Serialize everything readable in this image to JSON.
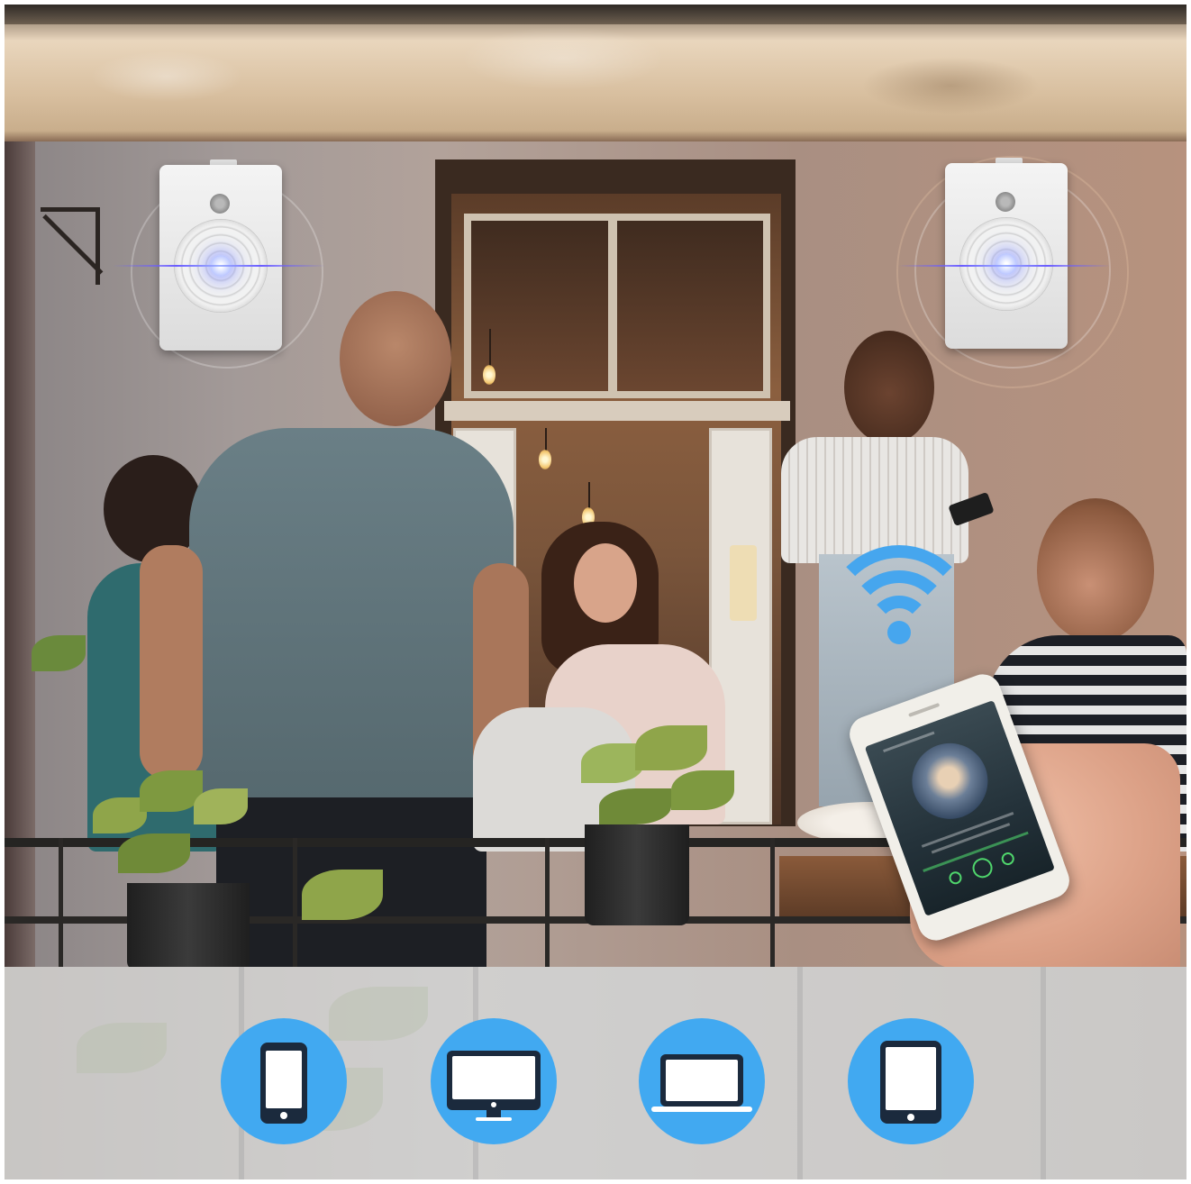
{
  "scene": {
    "description_free": true
  },
  "icons": {
    "devices": [
      "smartphone-icon",
      "desktop-monitor-icon",
      "laptop-icon",
      "tablet-icon"
    ],
    "wifi": "wifi-icon"
  },
  "colors": {
    "accent_blue": "#41a9f1",
    "wifi_blue": "#46a6ee",
    "beam_violet": "#6a5cff",
    "player_green": "#4fd66c"
  }
}
